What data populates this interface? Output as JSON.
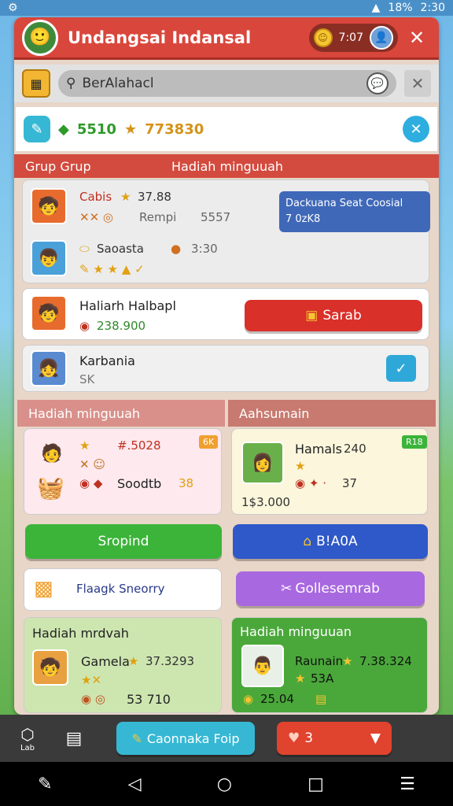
{
  "statusbar": {
    "battery": "18%",
    "time": "2:30"
  },
  "header": {
    "title": "Undangsai Indansal",
    "timer": "7:07",
    "close": "✕"
  },
  "search": {
    "value": "BerAlahacl",
    "clear": "✕"
  },
  "currency": {
    "green_amount": "5510",
    "gold_amount": "773830",
    "close": "✕"
  },
  "section1": {
    "left_header": "Grup Grup",
    "right_header": "Hadiah minguuah"
  },
  "card1": {
    "row1_name": "Cabis",
    "row1_value": "37.88",
    "row1_sub": "Rempi",
    "row1_sub_value": "5557",
    "row2_name": "Saoasta",
    "row2_time": "3:30",
    "info_title": "Dackuana Seat Coosial",
    "info_sub": "7  0zK8"
  },
  "card2": {
    "name": "Haliarh Halbapl",
    "amount": "238.900",
    "button": "Sarab"
  },
  "card3": {
    "name": "Karbania",
    "sub": "SK"
  },
  "col_left": {
    "header": "Hadiah minguuah",
    "value1": "#.5028",
    "value2": "Soodtb",
    "value2_num": "38",
    "badge": "6K"
  },
  "col_right": {
    "header": "Aahsumain",
    "name": "Hamals",
    "num": "240",
    "score": "37",
    "price": "1$3.000",
    "badge": "R18"
  },
  "buttons": {
    "green": "Sropind",
    "blue": "B!A0A"
  },
  "links": {
    "left": "Flaagk Sneorry",
    "right": "Gollesemrab"
  },
  "bottom_left": {
    "header": "Hadiah mrdvah",
    "name": "Gamela",
    "num": "37.3293",
    "num2": "53 710"
  },
  "bottom_right": {
    "header": "Hadiah minguuan",
    "name": "Raunain",
    "num": "7.38.324",
    "sub": "53A",
    "amount": "25.04"
  },
  "bottombar": {
    "nav_label": "Lab",
    "cta": "Caonnaka Foip",
    "hearts": "3"
  },
  "colors": {
    "red": "#d9463c",
    "green": "#3cb43a",
    "blue": "#2f58c8",
    "gold": "#f6c531"
  }
}
